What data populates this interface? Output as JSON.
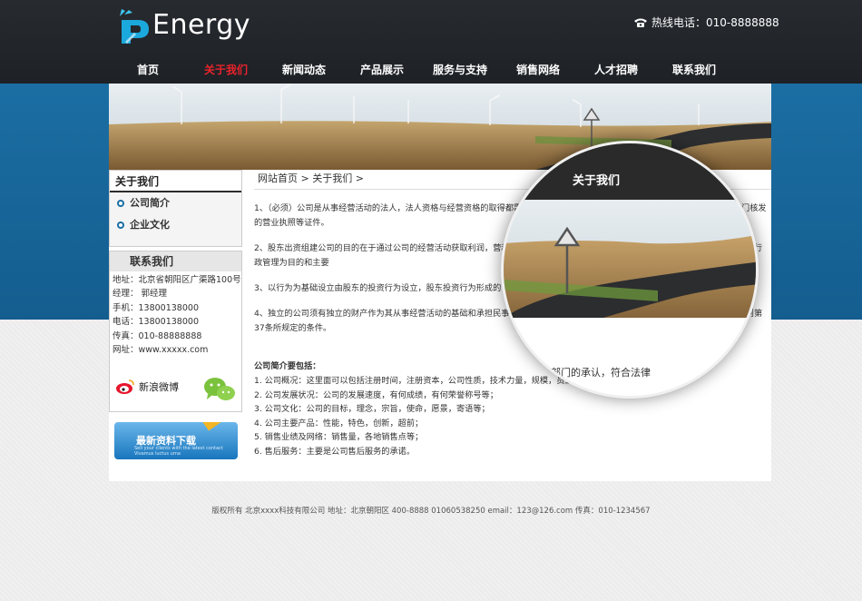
{
  "header": {
    "brand": "Energy",
    "hotline": "热线电话：010-8888888"
  },
  "nav": {
    "items": [
      {
        "label": "首页",
        "active": false
      },
      {
        "label": "关于我们",
        "active": true
      },
      {
        "label": "新闻动态",
        "active": false
      },
      {
        "label": "产品展示",
        "active": false
      },
      {
        "label": "服务与支持",
        "active": false
      },
      {
        "label": "销售网络",
        "active": false
      },
      {
        "label": "人才招聘",
        "active": false
      },
      {
        "label": "联系我们",
        "active": false
      }
    ]
  },
  "sidebar": {
    "title": "关于我们",
    "links": [
      "公司简介",
      "企业文化"
    ]
  },
  "contact": {
    "title": "联系我们",
    "lines": [
      "地址：北京省朝阳区广渠路100号",
      "经理： 郭经理",
      "手机：13800138000",
      "电话：13800138000",
      "传真：010-88888888",
      "网址：www.xxxxx.com"
    ],
    "weibo": "新浪微博"
  },
  "download": {
    "title": "最新资料下载",
    "subtitle": "Sell your clients with the latest contact Vivamus luctus urna",
    "badge": "Sign up"
  },
  "breadcrumb": {
    "home": "网站首页",
    "current": "关于我们"
  },
  "main": {
    "paragraphs": [
      "1、（必须）公司是从事经营活动的法人，法人资格与经营资格的取得都需要                                        规定的条件，履行法律规定的程序，取得国家相关行政部门核发的营业执照等证件。",
      "2、股东出资组建公司的目的在于通过公司的经营活动获取利润，营利                                        益法人，以行政管理为目的的国家机关以及非商事性公司。以从事行政管理为目的和主要",
      "3、以行为为基础设立由股东的投资行为设立，股东投资行为形成的                                              权，亦不同于债权。",
      "4、独立的公司须有独立的财产作为其从事经营活动的基础和承担民事                                              股份有限公司是企业法人。”公司作为法人，必须具备我国民法通则第37条所规定的条件。"
    ],
    "info_title": "公司简介要包括：",
    "info_items": [
      "1.  公司概况：这里面可以包括注册时间，注册资本，公司性质，技术力量，规模，员工人数，员工素质等；",
      "2.  公司发展状况：公司的发展速度，有何成绩，有何荣誉称号等；",
      "3.  公司文化：公司的目标，理念，宗旨，使命，愿景，寄语等；",
      "4.  公司主要产品：性能，特色，创新，超前；",
      "5.  销售业绩及网络：销售量，各地销售点等；",
      "6.  售后服务：主要是公司售后服务的承诺。"
    ]
  },
  "magnifier": {
    "title": "关于我们",
    "text": "行政部门的承认，符合法律"
  },
  "footer": {
    "text": "版权所有 北京xxxx科技有限公司 地址：北京朝阳区 400-8888 01060538250 email：123@126.com 传真：010-1234567"
  }
}
